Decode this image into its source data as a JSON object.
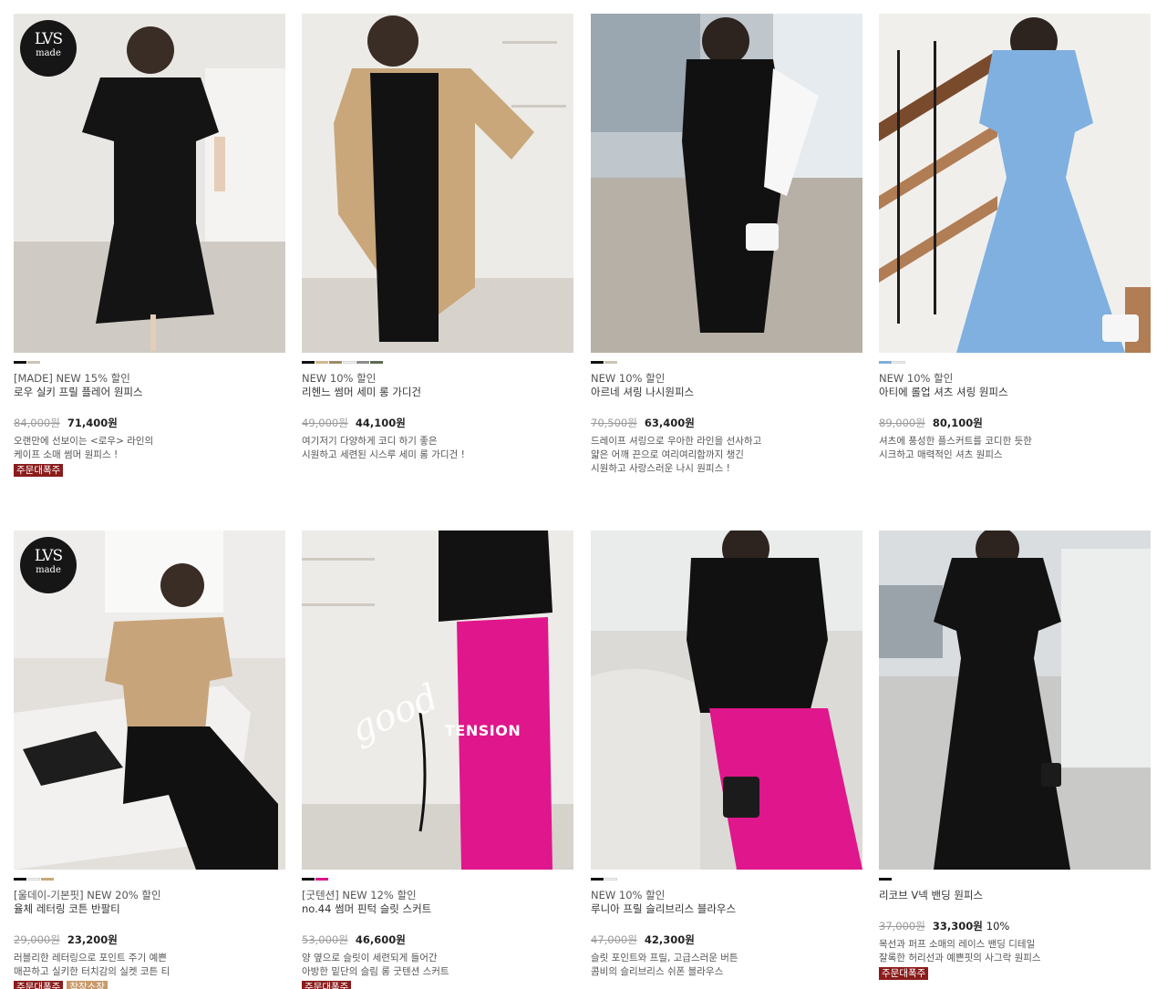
{
  "colors": {
    "badge_hot": "#8b1c1c",
    "badge_sale": "#c99a6b",
    "price_old": "#9a9a9a"
  },
  "products": [
    {
      "logo": {
        "mono": "LVS",
        "sub": "made"
      },
      "swatches": [
        "#111111",
        "#cfc4b4"
      ],
      "label": "[MADE] NEW 15% 할인",
      "name": "로우 실키 프릴 플레어 원피스",
      "old_price": "84,000원",
      "price": "71,400원",
      "discount": "",
      "desc": [
        "오랜만에 선보이는 <로우> 라인의",
        "케이프 소매 썸머 원피스 !"
      ],
      "badges": [
        {
          "text": "주문대폭주",
          "kind": "hot"
        }
      ]
    },
    {
      "swatches": [
        "#111111",
        "#d4b88e",
        "#a08a6a",
        "#f2f2f2",
        "#8c8c8c",
        "#5c6b52"
      ],
      "label": "NEW 10% 할인",
      "name": "리헨느 썸머 세미 롱 가디건",
      "old_price": "49,000원",
      "price": "44,100원",
      "discount": "",
      "desc": [
        "여기저기 다양하게 코디 하기 좋은",
        "시원하고 세련된 시스루 세미 롱 가디건 !"
      ],
      "badges": []
    },
    {
      "swatches": [
        "#111111",
        "#cfc4b4"
      ],
      "label": "NEW 10% 할인",
      "name": "아르네 셔링 나시원피스",
      "old_price": "70,500원",
      "price": "63,400원",
      "discount": "",
      "desc": [
        "드레이프 셔링으로 우아한 라인을 선사하고",
        "얇은 어깨 끈으로 여리여리함까지 챙긴",
        "시원하고 사랑스러운 나시 원피스 !"
      ],
      "badges": []
    },
    {
      "swatches": [
        "#7fb0d8",
        "#e8f0f6"
      ],
      "label": "NEW 10% 할인",
      "name": "아티에 롤업 셔츠 셔링 원피스",
      "old_price": "89,000원",
      "price": "80,100원",
      "discount": "",
      "desc": [
        "셔츠에 풍성한 플스커트를 코디한 듯한",
        "시크하고 매력적인 셔츠 원피스"
      ],
      "badges": []
    },
    {
      "logo": {
        "mono": "LVS",
        "sub": "made"
      },
      "swatches": [
        "#111111",
        "#f2f2f2",
        "#c8a878"
      ],
      "label": "[울데이-기본핏] NEW 20% 할인",
      "name": "율체 레터링 코튼 반팔티",
      "old_price": "29,000원",
      "price": "23,200원",
      "discount": "",
      "desc": [
        "러블리한 레터링으로 포인트 주기 예쁜",
        "매끈하고 실키한 터치감의 실켓 코튼 티"
      ],
      "badges": [
        {
          "text": "주문대폭주",
          "kind": "hot"
        },
        {
          "text": "착장소장",
          "kind": "sale"
        }
      ]
    },
    {
      "overlay": {
        "script": "good",
        "caps": "TENSION"
      },
      "swatches": [
        "#111111",
        "#e0168c"
      ],
      "label": "[굿텐션] NEW 12% 할인",
      "name": "no.44 썸머 핀턱 슬릿 스커트",
      "old_price": "53,000원",
      "price": "46,600원",
      "discount": "",
      "desc": [
        "양 옆으로 슬릿이 세련되게 들어간",
        "아방한 밑단의 슬림 롱 굿텐션 스커트"
      ],
      "badges": [
        {
          "text": "주문대폭주",
          "kind": "hot"
        }
      ]
    },
    {
      "swatches": [
        "#111111",
        "#f2f2f2"
      ],
      "label": "NEW 10% 할인",
      "name": "루니아 프릴 슬리브리스 블라우스",
      "old_price": "47,000원",
      "price": "42,300원",
      "discount": "",
      "desc": [
        "슬릿 포인트와 프릴, 고급스러운 버튼",
        "콤비의 슬리브리스 쉬폰 블라우스"
      ],
      "badges": []
    },
    {
      "swatches": [
        "#111111"
      ],
      "label": "",
      "name": "리코브 V넥 밴딩 원피스",
      "old_price": "37,000원",
      "price": "33,300원",
      "discount": "10%",
      "desc": [
        "목선과 퍼프 소매의 레이스 밴딩 디테일",
        "잘록한 허리선과 예쁜핏의 사그락 원피스"
      ],
      "badges": [
        {
          "text": "주문대폭주",
          "kind": "hot"
        }
      ]
    }
  ]
}
